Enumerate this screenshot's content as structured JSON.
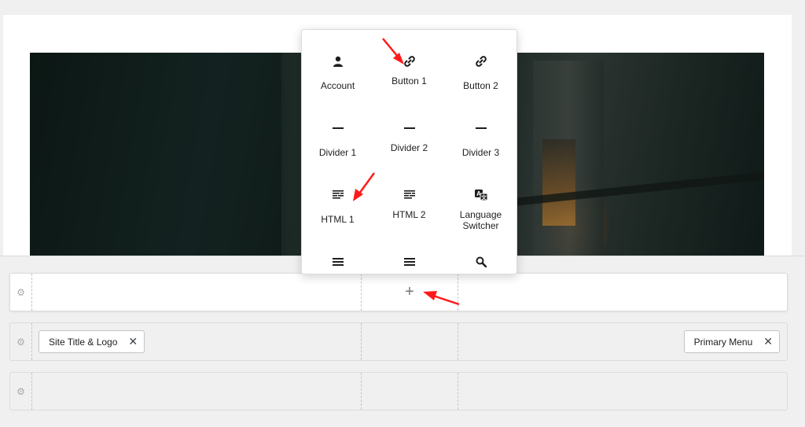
{
  "popup": {
    "items": [
      {
        "label": "Account",
        "icon": "user-icon"
      },
      {
        "label": "Button 1",
        "icon": "link-icon"
      },
      {
        "label": "Button 2",
        "icon": "link-icon"
      },
      {
        "label": "Divider 1",
        "icon": "divider-icon"
      },
      {
        "label": "Divider 2",
        "icon": "divider-icon"
      },
      {
        "label": "Divider 3",
        "icon": "divider-icon"
      },
      {
        "label": "HTML 1",
        "icon": "html-icon"
      },
      {
        "label": "HTML 2",
        "icon": "html-icon"
      },
      {
        "label": "Language Switcher",
        "icon": "translate-icon"
      },
      {
        "label": "",
        "icon": "menu-icon"
      },
      {
        "label": "",
        "icon": "menu-icon"
      },
      {
        "label": "",
        "icon": "search-icon"
      }
    ]
  },
  "rows": {
    "top": {
      "add_label": "+"
    },
    "main": {
      "left_chip": "Site Title & Logo",
      "right_chip": "Primary Menu",
      "remove_glyph": "✕"
    }
  },
  "colors": {
    "arrow": "#ff1a1a"
  }
}
